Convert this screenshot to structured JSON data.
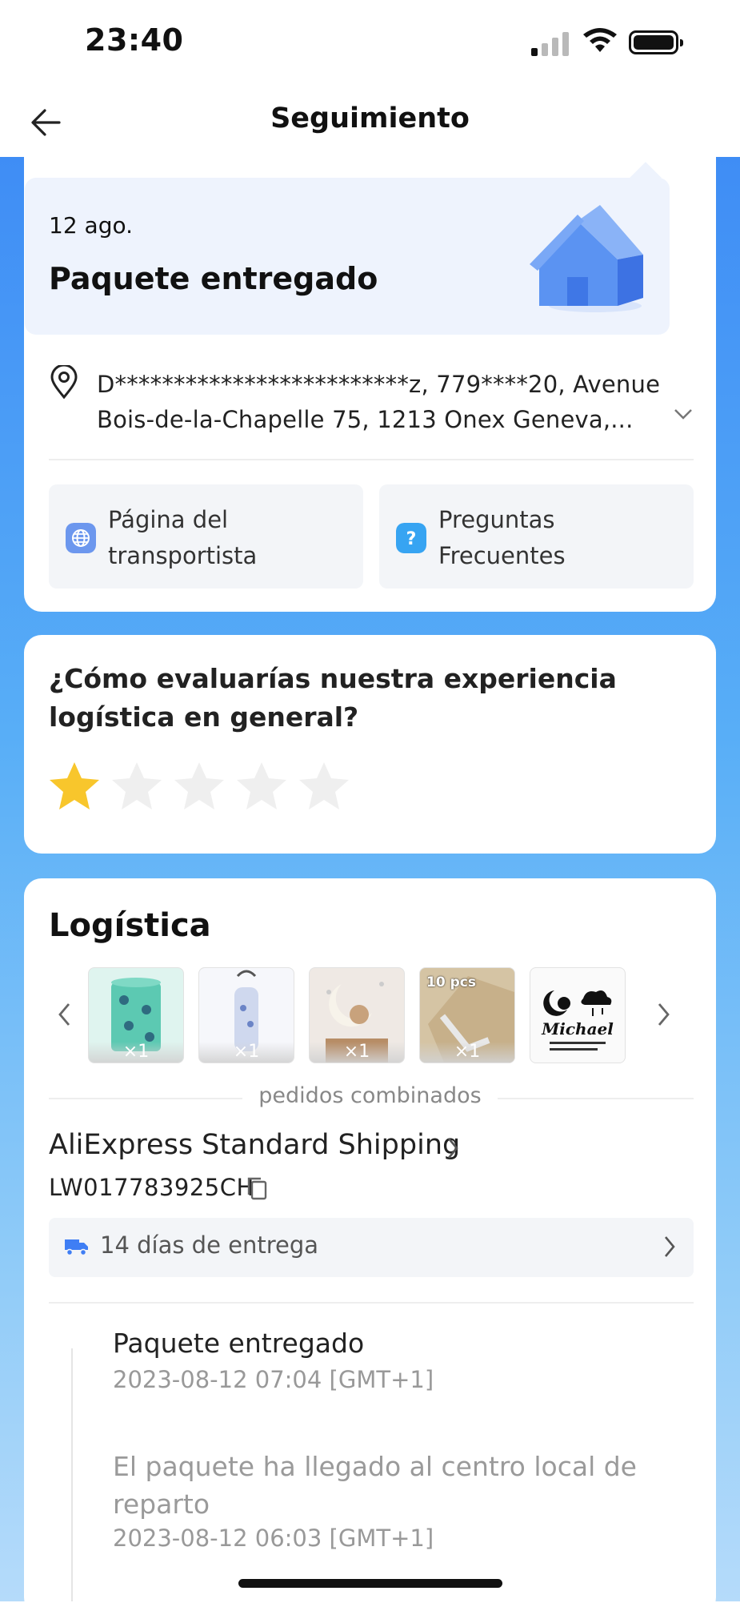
{
  "status_bar": {
    "time": "23:40"
  },
  "header": {
    "title": "Seguimiento",
    "back_icon": "arrow-left-icon"
  },
  "delivery": {
    "date": "12 ago.",
    "status": "Paquete entregado",
    "address": "D*************************z,  779****20,  Avenue Bois-de-la-Chapelle 75, 1213 Onex Geneva,..."
  },
  "actions": {
    "carrier_page": "Página del transportista",
    "faq": "Preguntas Frecuentes"
  },
  "rating": {
    "question": "¿Cómo evaluarías nuestra experiencia logística en general?",
    "stars_filled": 1,
    "stars_total": 5,
    "filled_color": "#f8c62c",
    "empty_color": "#efefef"
  },
  "logistics": {
    "title": "Logística",
    "items": [
      {
        "qty": "×1",
        "icon": "hamper-icon"
      },
      {
        "qty": "×1",
        "icon": "bottle-bag-icon"
      },
      {
        "qty": "×1",
        "icon": "wall-sticker-icon"
      },
      {
        "qty": "×1",
        "badge": "10 pcs",
        "icon": "hooks-icon"
      },
      {
        "qty": "",
        "caption": "Michael",
        "icon": "name-sticker-icon"
      }
    ],
    "combined_label": "pedidos combinados",
    "carrier": "AliExpress Standard Shipping",
    "tracking_number": "LW017783925CH",
    "eta": "14 días de entrega"
  },
  "timeline": [
    {
      "title": "Paquete entregado",
      "time": "2023-08-12 07:04 [GMT+1]",
      "active": true
    },
    {
      "title": "El paquete ha llegado al centro local de reparto",
      "time": "2023-08-12 06:03 [GMT+1]",
      "active": false
    }
  ],
  "colors": {
    "accent": "#3f7ef4",
    "brand_blue_bg": "#4a9cf6"
  }
}
